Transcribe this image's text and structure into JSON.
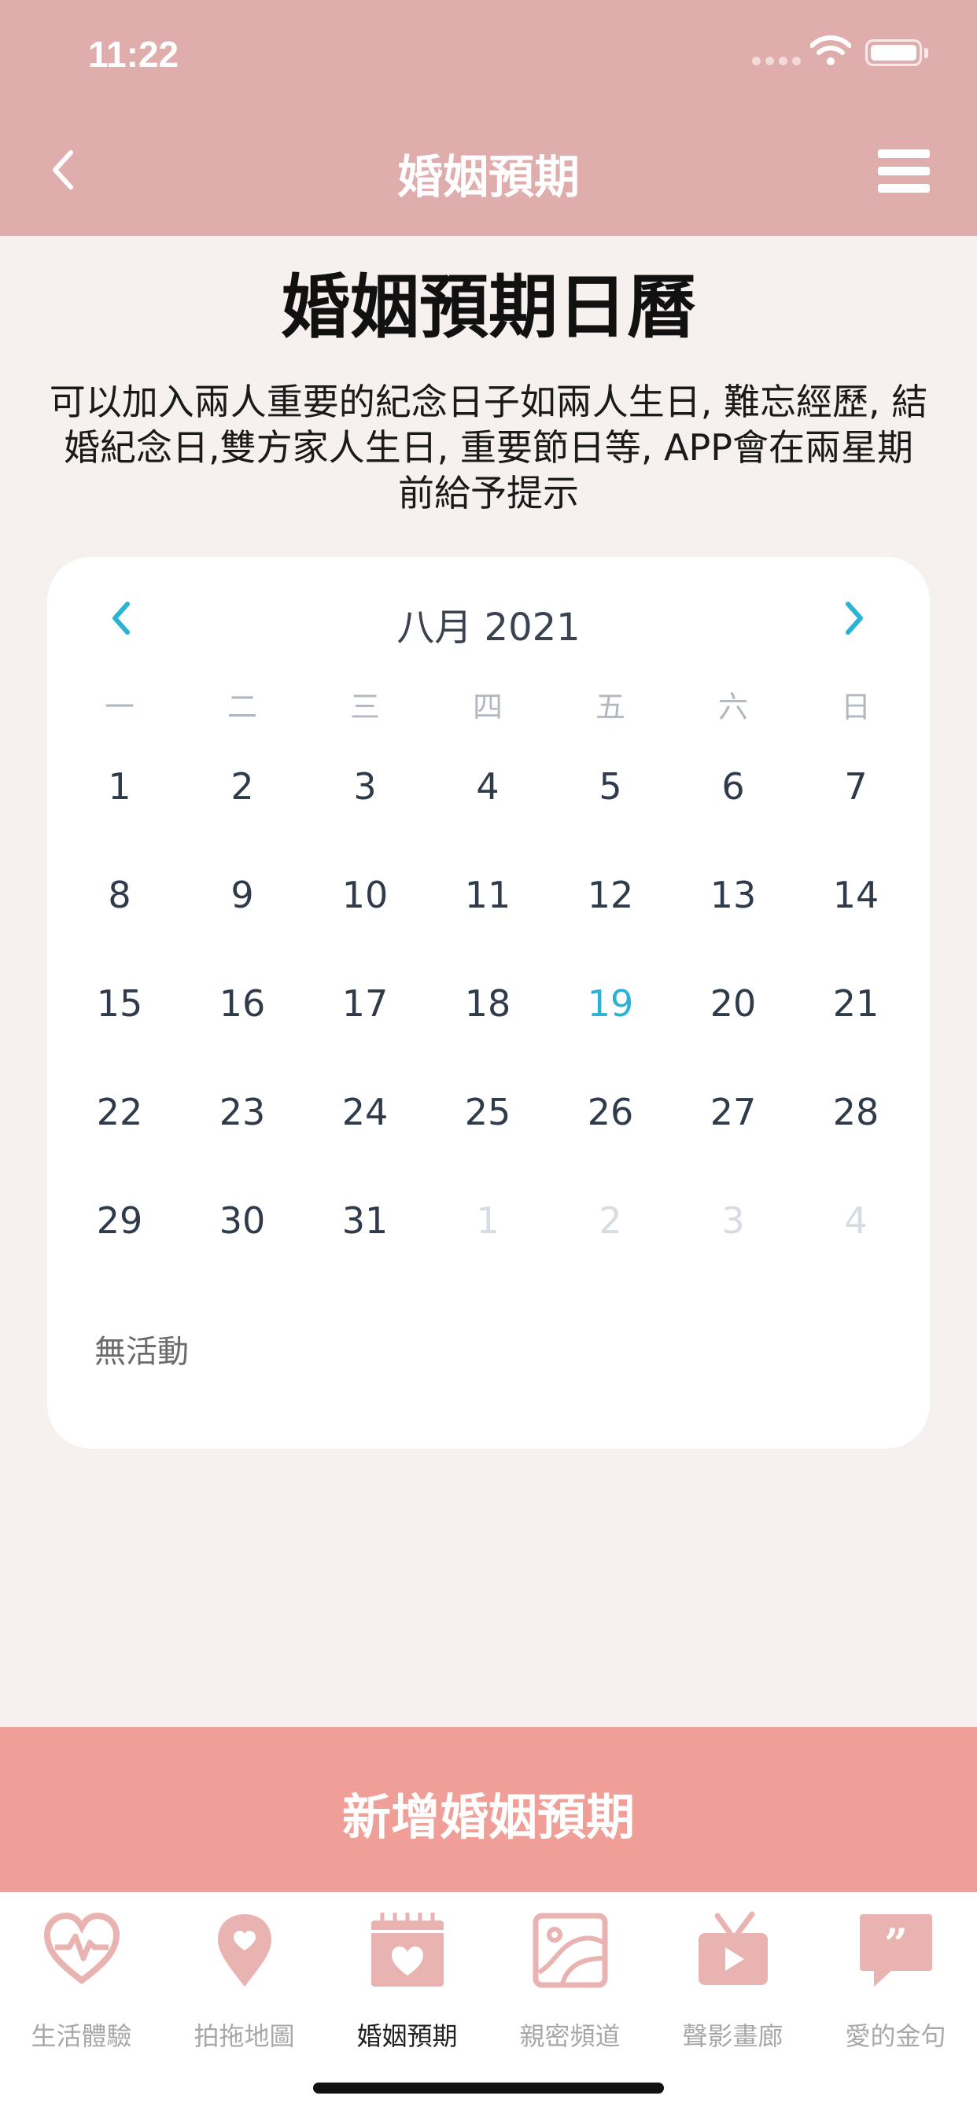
{
  "status_bar": {
    "time": "11:22"
  },
  "header": {
    "title": "婚姻預期"
  },
  "main": {
    "title": "婚姻預期日曆",
    "description": "可以加入兩人重要的紀念日子如兩人生日, 難忘經歷, 結婚紀念日,雙方家人生日, 重要節日等, APP會在兩星期前給予提示"
  },
  "calendar": {
    "month_label": "八月 2021",
    "weekdays": [
      "一",
      "二",
      "三",
      "四",
      "五",
      "六",
      "日"
    ],
    "weeks": [
      [
        "1",
        "2",
        "3",
        "4",
        "5",
        "6",
        "7"
      ],
      [
        "8",
        "9",
        "10",
        "11",
        "12",
        "13",
        "14"
      ],
      [
        "15",
        "16",
        "17",
        "18",
        "19",
        "20",
        "21"
      ],
      [
        "22",
        "23",
        "24",
        "25",
        "26",
        "27",
        "28"
      ],
      [
        "29",
        "30",
        "31",
        "1",
        "2",
        "3",
        "4"
      ]
    ],
    "today": "19",
    "no_event_text": "無活動"
  },
  "add_button": {
    "label": "新增婚姻預期"
  },
  "tabbar": {
    "tabs": [
      {
        "label": "生活體驗",
        "icon": "heartbeat-icon",
        "active": false
      },
      {
        "label": "拍拖地圖",
        "icon": "map-pin-heart-icon",
        "active": false
      },
      {
        "label": "婚姻預期",
        "icon": "calendar-heart-icon",
        "active": true
      },
      {
        "label": "親密頻道",
        "icon": "frame-icon",
        "active": false
      },
      {
        "label": "聲影畫廊",
        "icon": "tv-play-icon",
        "active": false
      },
      {
        "label": "愛的金句",
        "icon": "quote-bubble-icon",
        "active": false
      }
    ]
  },
  "colors": {
    "header": "#e0adad",
    "background": "#f6f0ee",
    "accent": "#2bb3d6",
    "add_button": "#ef9f98",
    "tab_icon": "#e8b3b0"
  }
}
